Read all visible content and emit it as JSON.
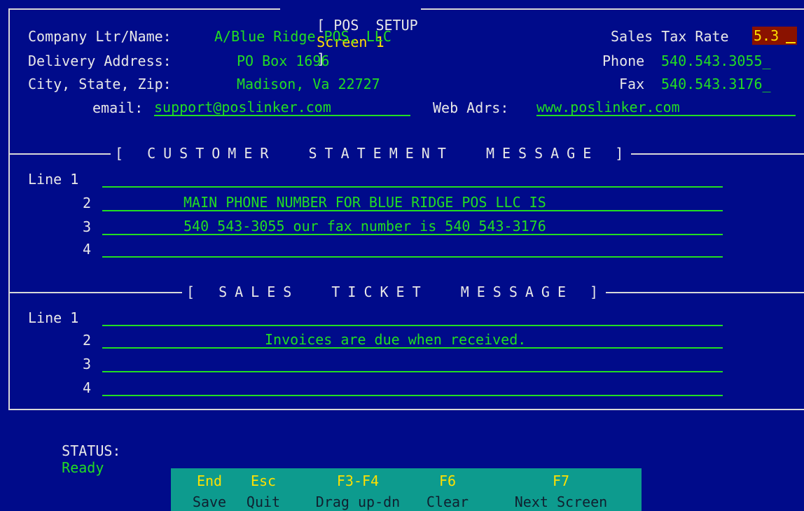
{
  "title": {
    "left": "[ POS  SETUP",
    "screen": "Screen 1",
    "right": "]"
  },
  "company": {
    "label": "Company Ltr/Name:",
    "value": "A/Blue Ridge POS, LLC",
    "tax_label": "Sales Tax Rate",
    "tax_value": "5.3"
  },
  "delivery": {
    "label": "Delivery Address:",
    "value": "PO Box 1696",
    "phone_label": "Phone",
    "phone_value": "540.543.3055_"
  },
  "city": {
    "label": "City, State, Zip:",
    "value": "Madison, Va 22727",
    "fax_label": "Fax",
    "fax_value": "540.543.3176_"
  },
  "email": {
    "label": "email:",
    "value": "support@poslinker.com",
    "web_label": "Web Adrs:",
    "web_value": "www.poslinker.com"
  },
  "customer_msg": {
    "heading": "[ CUSTOMER  STATEMENT  MESSAGE ]",
    "lines": [
      {
        "label": "Line 1",
        "text": ""
      },
      {
        "label": "2",
        "text": "MAIN PHONE NUMBER FOR BLUE RIDGE POS LLC IS"
      },
      {
        "label": "3",
        "text": "540 543-3055 our fax number is 540 543-3176"
      },
      {
        "label": "4",
        "text": ""
      }
    ]
  },
  "ticket_msg": {
    "heading": "[ SALES  TICKET  MESSAGE ]",
    "lines": [
      {
        "label": "Line 1",
        "text": ""
      },
      {
        "label": "2",
        "text": "Invoices are due when received."
      },
      {
        "label": "3",
        "text": ""
      },
      {
        "label": "4",
        "text": ""
      }
    ]
  },
  "status": {
    "label": "STATUS:",
    "value": "Ready"
  },
  "fkeys": [
    {
      "key": "End",
      "action": "Save"
    },
    {
      "key": "Esc",
      "action": "Quit"
    },
    {
      "key": "F3-F4",
      "action": "Drag up-dn"
    },
    {
      "key": "F6",
      "action": "Clear"
    },
    {
      "key": "F7",
      "action": "Next Screen"
    }
  ],
  "colors": {
    "background": "#000b8a",
    "field_text": "#22dd22",
    "highlight": "#ffe000",
    "tax_field": "#8a1200",
    "fkey_bar": "#0d9b8e"
  }
}
